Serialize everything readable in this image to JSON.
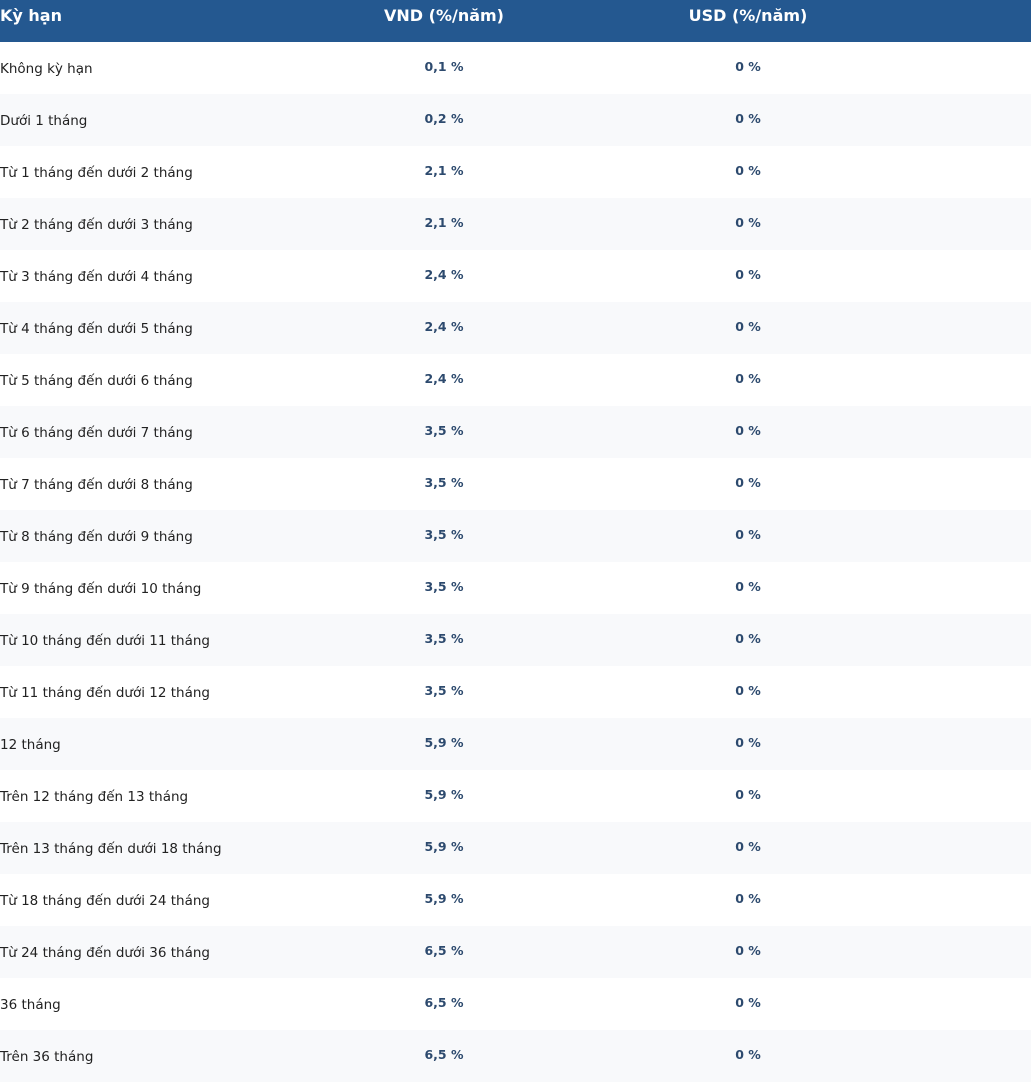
{
  "table": {
    "headers": {
      "term": "Kỳ hạn",
      "vnd": "VND (%/năm)",
      "usd": "USD (%/năm)"
    },
    "rows": [
      {
        "term": "Không kỳ hạn",
        "vnd": "0,1 %",
        "usd": "0 %"
      },
      {
        "term": "Dưới 1 tháng",
        "vnd": "0,2 %",
        "usd": "0 %"
      },
      {
        "term": "Từ 1 tháng đến dưới 2 tháng",
        "vnd": "2,1 %",
        "usd": "0 %"
      },
      {
        "term": "Từ 2 tháng đến dưới 3 tháng",
        "vnd": "2,1 %",
        "usd": "0 %"
      },
      {
        "term": "Từ 3 tháng đến dưới 4 tháng",
        "vnd": "2,4 %",
        "usd": "0 %"
      },
      {
        "term": "Từ 4 tháng đến dưới 5 tháng",
        "vnd": "2,4 %",
        "usd": "0 %"
      },
      {
        "term": "Từ 5 tháng đến dưới 6 tháng",
        "vnd": "2,4 %",
        "usd": "0 %"
      },
      {
        "term": "Từ 6 tháng đến dưới 7 tháng",
        "vnd": "3,5 %",
        "usd": "0 %"
      },
      {
        "term": "Từ 7 tháng đến dưới 8 tháng",
        "vnd": "3,5 %",
        "usd": "0 %"
      },
      {
        "term": "Từ 8 tháng đến dưới 9 tháng",
        "vnd": "3,5 %",
        "usd": "0 %"
      },
      {
        "term": "Từ 9 tháng đến dưới 10 tháng",
        "vnd": "3,5 %",
        "usd": "0 %"
      },
      {
        "term": "Từ 10 tháng đến dưới 11 tháng",
        "vnd": "3,5 %",
        "usd": "0 %"
      },
      {
        "term": "Từ 11 tháng đến dưới 12 tháng",
        "vnd": "3,5 %",
        "usd": "0 %"
      },
      {
        "term": "12 tháng",
        "vnd": "5,9 %",
        "usd": "0 %"
      },
      {
        "term": "Trên 12 tháng đến 13 tháng",
        "vnd": "5,9 %",
        "usd": "0 %"
      },
      {
        "term": "Trên 13 tháng đến dưới 18 tháng",
        "vnd": "5,9 %",
        "usd": "0 %"
      },
      {
        "term": "Từ 18 tháng đến dưới 24 tháng",
        "vnd": "5,9 %",
        "usd": "0 %"
      },
      {
        "term": "Từ 24 tháng đến dưới 36 tháng",
        "vnd": "6,5 %",
        "usd": "0 %"
      },
      {
        "term": "36 tháng",
        "vnd": "6,5 %",
        "usd": "0 %"
      },
      {
        "term": "Trên 36 tháng",
        "vnd": "6,5 %",
        "usd": "0 %"
      }
    ]
  },
  "colors": {
    "header_bg": "#245890",
    "header_text": "#ffffff",
    "row_alt_bg": "#f8f9fb",
    "value_text": "#2d4a6e",
    "term_text": "#222222"
  }
}
